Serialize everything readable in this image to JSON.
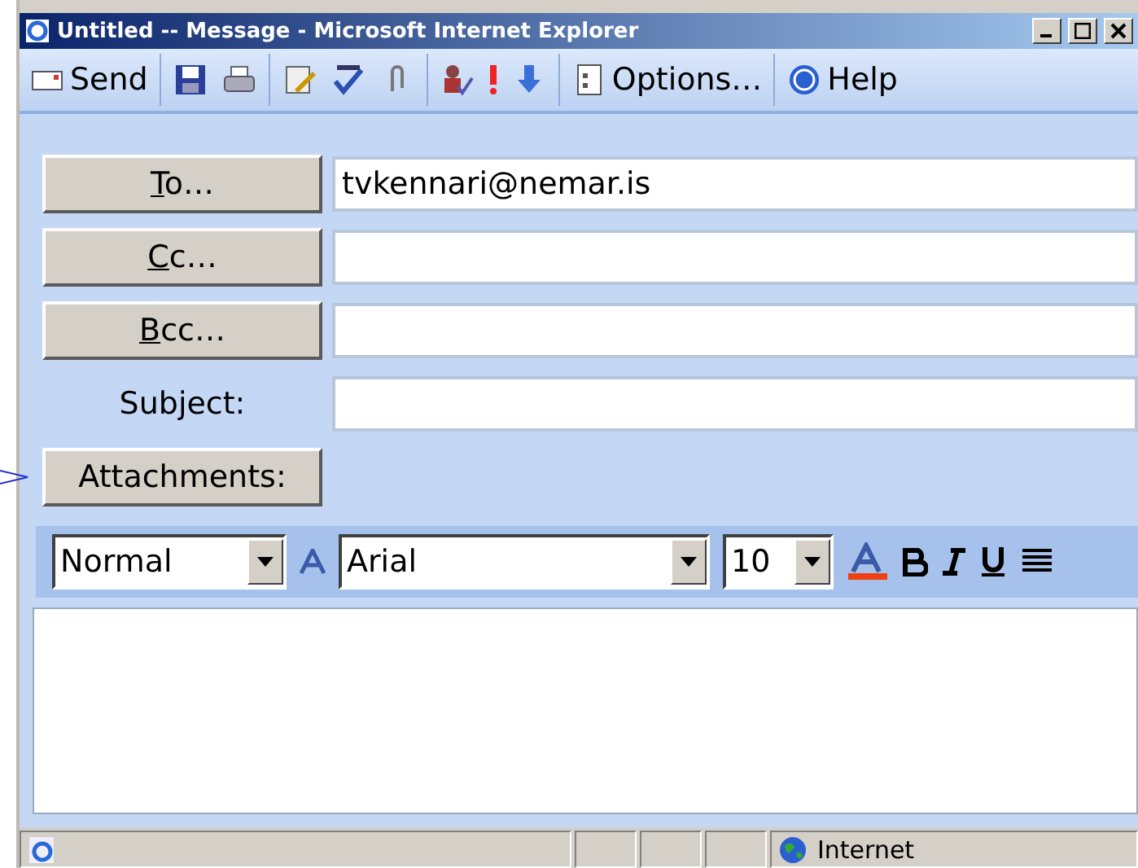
{
  "window": {
    "title": "Untitled -- Message - Microsoft Internet Explorer"
  },
  "toolbar": [
    {
      "kind": "send",
      "label": "Send"
    },
    {
      "kind": "sep"
    },
    {
      "kind": "save"
    },
    {
      "kind": "print"
    },
    {
      "kind": "sep"
    },
    {
      "kind": "edit"
    },
    {
      "kind": "spell"
    },
    {
      "kind": "attach"
    },
    {
      "kind": "sep"
    },
    {
      "kind": "names"
    },
    {
      "kind": "high"
    },
    {
      "kind": "low"
    },
    {
      "kind": "sep"
    },
    {
      "kind": "options",
      "label": "Options…"
    },
    {
      "kind": "sep"
    },
    {
      "kind": "help",
      "label": "Help"
    }
  ],
  "address_rows": [
    {
      "kind": "button",
      "label": "To…",
      "mnemonic_underlined": true,
      "value": "tvkennari@nemar.is"
    },
    {
      "kind": "button",
      "label": "Cc…",
      "mnemonic_underlined": true
    },
    {
      "kind": "button",
      "label": "Bcc…",
      "mnemonic_underlined": true
    },
    {
      "kind": "label",
      "label": "Subject:"
    },
    {
      "kind": "attach",
      "label": "Attachments:"
    }
  ],
  "format_bar": {
    "style": "Normal",
    "font": "Arial",
    "size": "10"
  },
  "status_bar": {
    "zone": "Internet"
  }
}
